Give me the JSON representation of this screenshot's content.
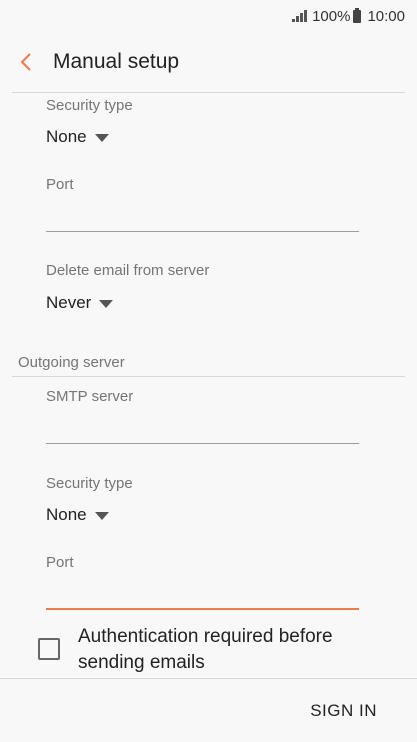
{
  "status_bar": {
    "battery": "100%",
    "time": "10:00"
  },
  "header": {
    "title": "Manual setup"
  },
  "incoming": {
    "security_type": {
      "label": "Security type",
      "value": "None"
    },
    "port": {
      "label": "Port",
      "value": ""
    },
    "delete_email": {
      "label": "Delete email from server",
      "value": "Never"
    }
  },
  "outgoing": {
    "section_title": "Outgoing server",
    "smtp_server": {
      "label": "SMTP server",
      "value": ""
    },
    "security_type": {
      "label": "Security type",
      "value": "None"
    },
    "port": {
      "label": "Port",
      "value": ""
    }
  },
  "authentication": {
    "label_line1": "Authentication required before",
    "label_line2": "sending emails",
    "checked": false
  },
  "actions": {
    "sign_in": "SIGN IN"
  },
  "colors": {
    "accent": "#ec7b4a",
    "background": "#f8f8f8"
  }
}
